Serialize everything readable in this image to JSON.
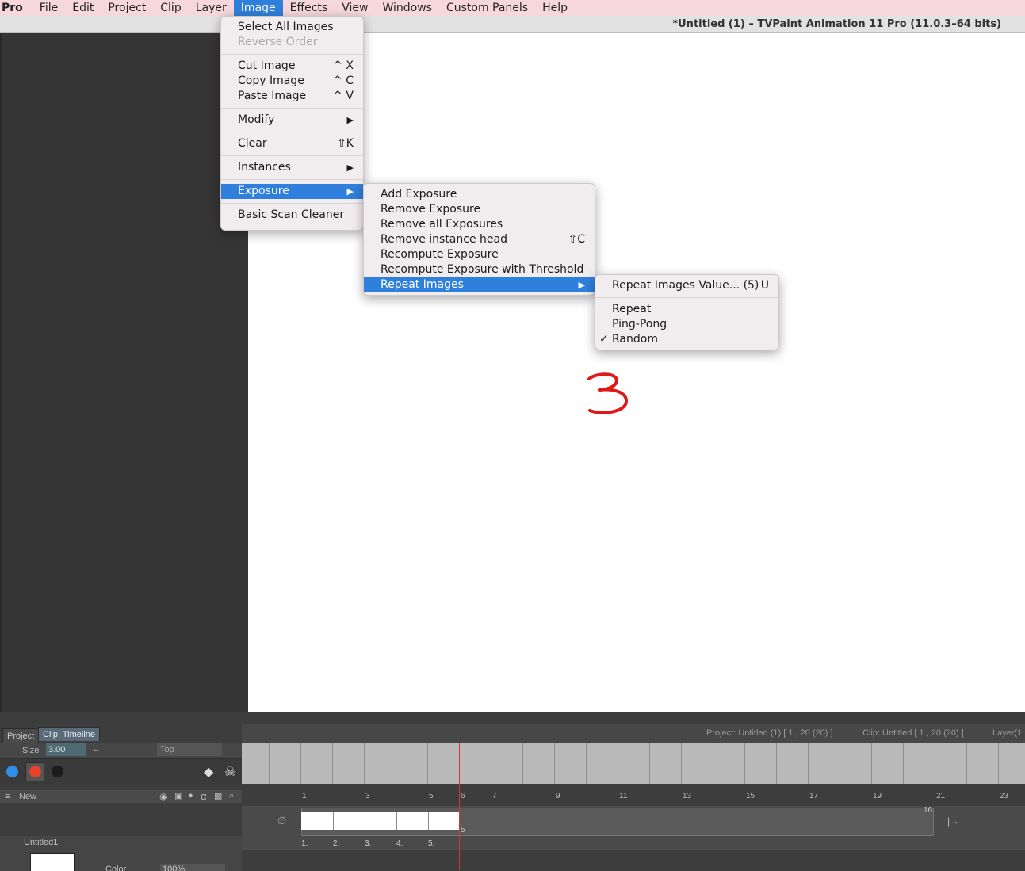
{
  "menubar": {
    "items": [
      "Pro",
      "File",
      "Edit",
      "Project",
      "Clip",
      "Layer",
      "Image",
      "Effects",
      "View",
      "Windows",
      "Custom Panels",
      "Help"
    ],
    "active": "Image"
  },
  "window": {
    "title": "*Untitled (1) – TVPaint Animation 11 Pro (11.0.3–64 bits)"
  },
  "image_menu": {
    "select_all": "Select All Images",
    "reverse_order": "Reverse Order",
    "cut": "Cut Image",
    "cut_sc": "^ X",
    "copy": "Copy Image",
    "copy_sc": "^ C",
    "paste": "Paste Image",
    "paste_sc": "^ V",
    "modify": "Modify",
    "clear": "Clear",
    "clear_sc": "⇧K",
    "instances": "Instances",
    "exposure": "Exposure",
    "basic_scan": "Basic Scan Cleaner",
    "arrow": "▶"
  },
  "exposure_menu": {
    "add": "Add Exposure",
    "remove": "Remove Exposure",
    "remove_all": "Remove all Exposures",
    "remove_head": "Remove instance head",
    "remove_head_sc": "⇧C",
    "recompute": "Recompute Exposure",
    "recompute_threshold": "Recompute Exposure with Threshold",
    "repeat_images": "Repeat Images"
  },
  "repeat_menu": {
    "value": "Repeat Images Value... (5)",
    "value_sc": "U",
    "repeat": "Repeat",
    "ping_pong": "Ping-Pong",
    "random": "Random",
    "check": "✓"
  },
  "timeline": {
    "tab_project": "Project",
    "tab_clip": "Clip: Timeline",
    "info_project": "Project: Untitled (1) [ 1 , 20  (20) ]",
    "info_clip": "Clip: Untitled [ 1 , 20  (20) ]",
    "info_layer": "Layer(1",
    "size_label": "Size",
    "size_value": "3.00",
    "top_label": "Top",
    "new_label": "New",
    "layer_name": "Untitled1",
    "color_label": "Color",
    "opacity": "100%",
    "ruler": [
      "1",
      "3",
      "5",
      "6",
      "7",
      "9",
      "11",
      "13",
      "15",
      "17",
      "19",
      "21",
      "23"
    ],
    "frame_labels": [
      "1.",
      "2.",
      "3.",
      "4.",
      "5."
    ],
    "end_marker": "16",
    "five_marker": "5"
  },
  "colors": {
    "menubar": "#f5d7dc",
    "highlight": "#2f7fdc",
    "stroke": "#e01818"
  }
}
